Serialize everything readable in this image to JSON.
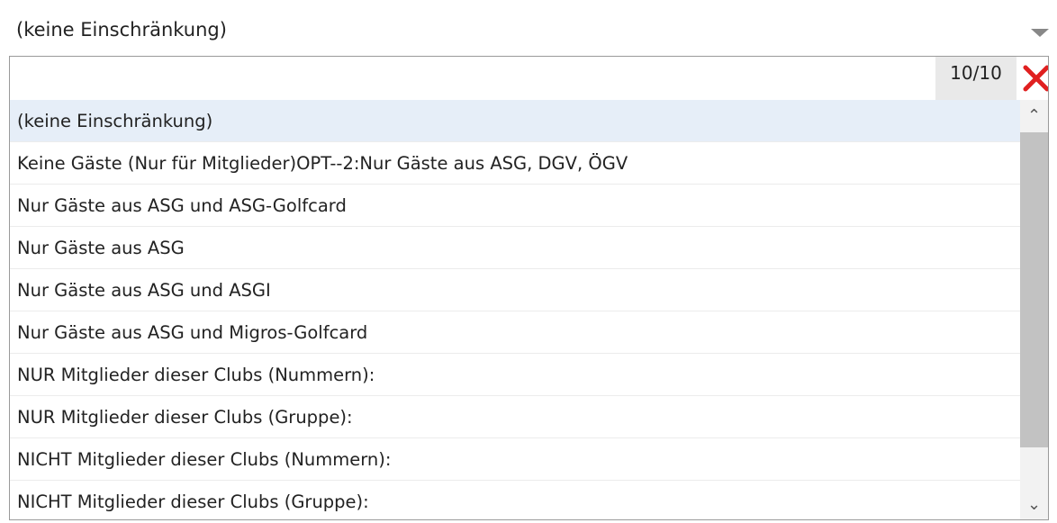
{
  "select": {
    "selected_value": "(keine Einschränkung)"
  },
  "dropdown": {
    "filter_value": "",
    "counter": "10/10",
    "options": [
      {
        "label": "(keine Einschränkung)",
        "selected": true
      },
      {
        "label": "Keine Gäste (Nur für Mitglieder)OPT--2:Nur Gäste aus ASG, DGV, ÖGV",
        "selected": false
      },
      {
        "label": "Nur Gäste aus ASG und ASG-Golfcard",
        "selected": false
      },
      {
        "label": "Nur Gäste aus ASG",
        "selected": false
      },
      {
        "label": "Nur Gäste aus ASG und ASGI",
        "selected": false
      },
      {
        "label": "Nur Gäste aus ASG und Migros-Golfcard",
        "selected": false
      },
      {
        "label": "NUR Mitglieder dieser Clubs (Nummern):",
        "selected": false
      },
      {
        "label": "NUR Mitglieder dieser Clubs (Gruppe):",
        "selected": false
      },
      {
        "label": "NICHT Mitglieder dieser Clubs (Nummern):",
        "selected": false
      },
      {
        "label": "NICHT Mitglieder dieser Clubs (Gruppe):",
        "selected": false
      }
    ]
  },
  "icons": {
    "clear": "close-icon",
    "dropdown_arrow": "chevron-down-icon",
    "scroll_up": "chevron-up-icon",
    "scroll_down": "chevron-down-icon"
  },
  "colors": {
    "clear_icon": "#e02020",
    "selected_option_bg": "#e6eef8",
    "scroll_thumb": "#c2c2c2"
  }
}
